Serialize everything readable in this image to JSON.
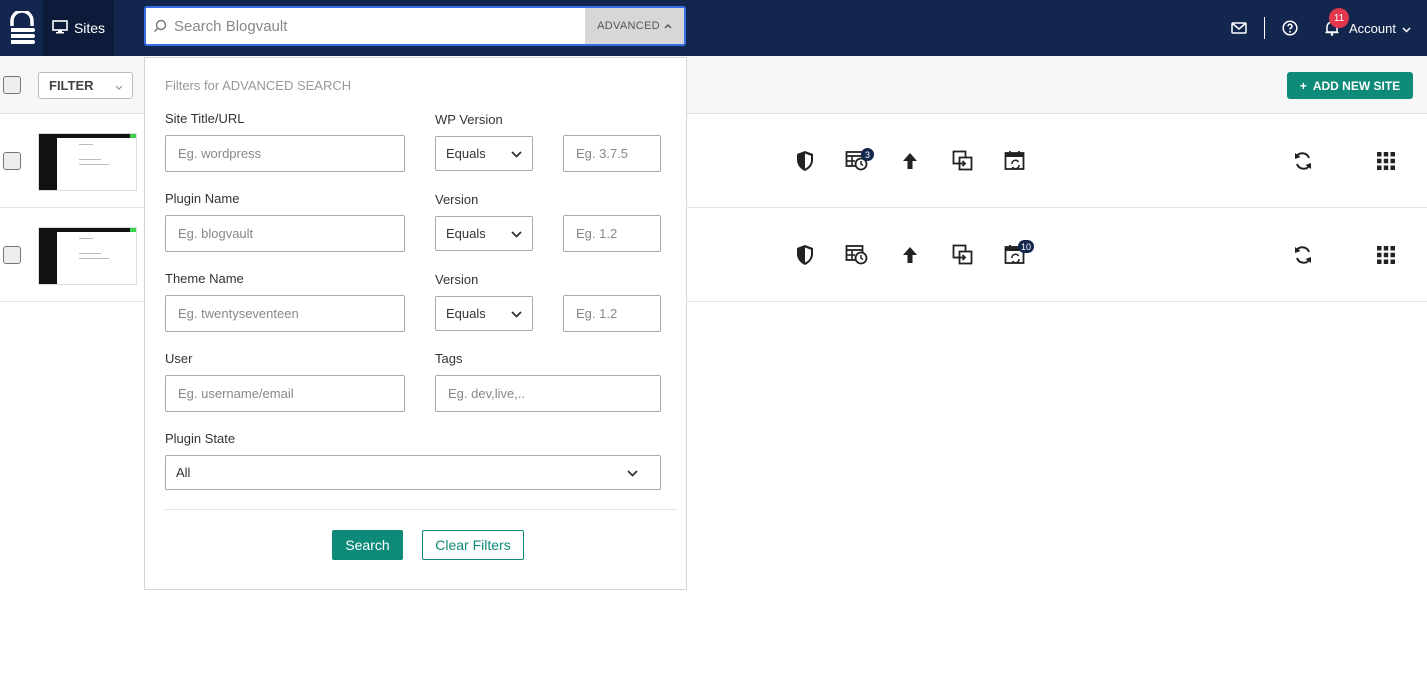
{
  "header": {
    "sites_label": "Sites",
    "search_placeholder": "Search Blogvault",
    "advanced_label": "ADVANCED",
    "notifications_count": "11",
    "account_label": "Account"
  },
  "toolbar": {
    "filter_label": "FILTER",
    "add_site_label": "ADD NEW SITE"
  },
  "rows": [
    {
      "backups_badge": "3",
      "schedule_badge": ""
    },
    {
      "backups_badge": "",
      "schedule_badge": "10"
    }
  ],
  "advanced_search": {
    "title": "Filters for ADVANCED SEARCH",
    "site_title_label": "Site Title/URL",
    "site_title_placeholder": "Eg. wordpress",
    "wp_version_label": "WP Version",
    "wp_version_op": "Equals",
    "wp_version_placeholder": "Eg. 3.7.5",
    "plugin_name_label": "Plugin Name",
    "plugin_name_placeholder": "Eg. blogvault",
    "plugin_version_label": "Version",
    "plugin_version_op": "Equals",
    "plugin_version_placeholder": "Eg. 1.2",
    "theme_name_label": "Theme Name",
    "theme_name_placeholder": "Eg. twentyseventeen",
    "theme_version_label": "Version",
    "theme_version_op": "Equals",
    "theme_version_placeholder": "Eg. 1.2",
    "user_label": "User",
    "user_placeholder": "Eg. username/email",
    "tags_label": "Tags",
    "tags_placeholder": "Eg. dev,live,..",
    "plugin_state_label": "Plugin State",
    "plugin_state_value": "All",
    "search_button": "Search",
    "clear_button": "Clear Filters"
  },
  "colors": {
    "header_bg": "#13264d",
    "accent": "#0e8a78",
    "focus": "#3a6ee8",
    "badge": "#e3374e"
  }
}
